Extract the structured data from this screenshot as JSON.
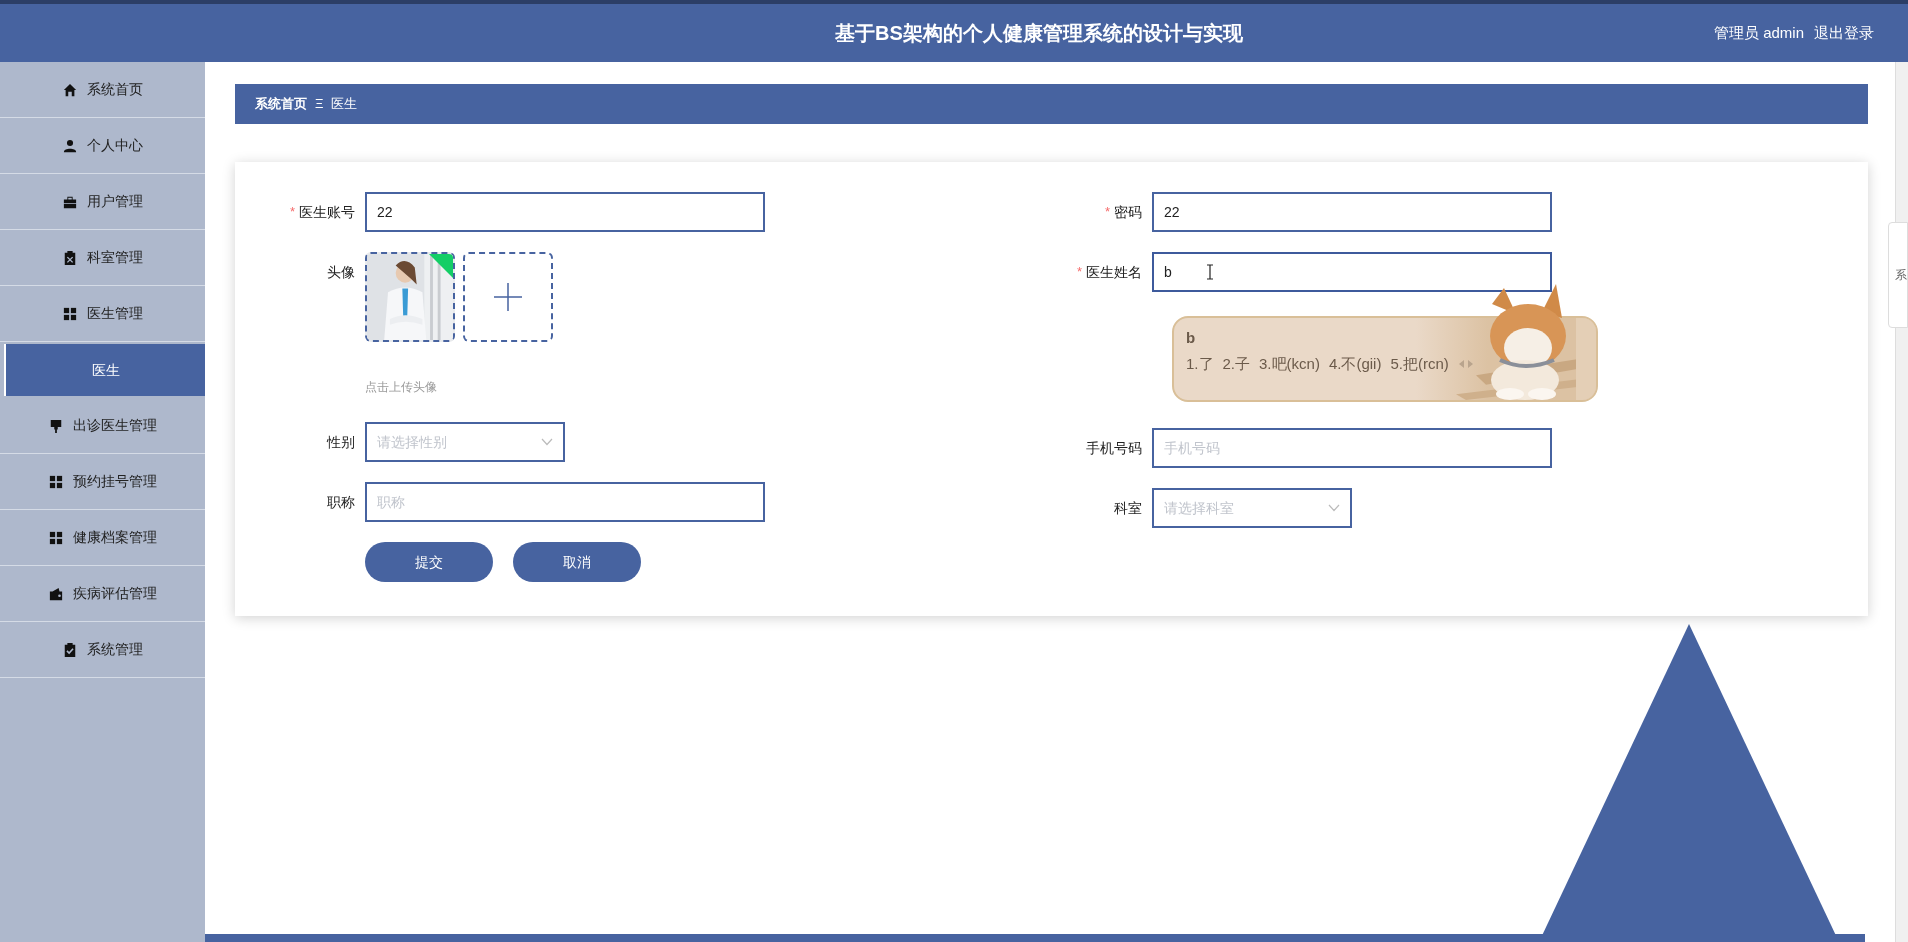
{
  "header": {
    "title": "基于BS架构的个人健康管理系统的设计与实现",
    "user": "管理员 admin",
    "logout": "退出登录"
  },
  "sidebar": {
    "items": [
      {
        "label": "系统首页",
        "selected": false
      },
      {
        "label": "个人中心",
        "selected": false
      },
      {
        "label": "用户管理",
        "selected": false
      },
      {
        "label": "科室管理",
        "selected": false
      },
      {
        "label": "医生管理",
        "selected": false
      },
      {
        "label": "医生",
        "selected": true
      },
      {
        "label": "出诊医生管理",
        "selected": false
      },
      {
        "label": "预约挂号管理",
        "selected": false
      },
      {
        "label": "健康档案管理",
        "selected": false
      },
      {
        "label": "疾病评估管理",
        "selected": false
      },
      {
        "label": "系统管理",
        "selected": false
      }
    ]
  },
  "breadcrumb": {
    "items": [
      "系统首页",
      "医生"
    ],
    "separator": "Ξ"
  },
  "form": {
    "left": [
      {
        "kind": "input",
        "required_mark": "*",
        "label": "医生账号",
        "value": "22"
      },
      {
        "kind": "upload",
        "label": "头像",
        "hint": "点击上传头像"
      },
      {
        "kind": "select",
        "label": "性别",
        "placeholder": "请选择性别"
      },
      {
        "kind": "input",
        "label": "职称",
        "placeholder": "职称"
      }
    ],
    "right": [
      {
        "kind": "input",
        "required_mark": "*",
        "label": "密码",
        "value": "22"
      },
      {
        "kind": "input",
        "required_mark": "*",
        "label": "医生姓名",
        "value": "b",
        "focused": true
      },
      {
        "kind": "ime"
      },
      {
        "kind": "input",
        "label": "手机号码",
        "placeholder": "手机号码"
      },
      {
        "kind": "select",
        "label": "科室",
        "placeholder": "请选择科室"
      }
    ],
    "buttons": [
      "提交",
      "取消"
    ]
  },
  "ime": {
    "composition": "b",
    "candidates": [
      "1.了",
      "2.子",
      "3.吧(kcn)",
      "4.不(gii)",
      "5.把(rcn)"
    ]
  },
  "side_tab": {
    "text": "系"
  }
}
